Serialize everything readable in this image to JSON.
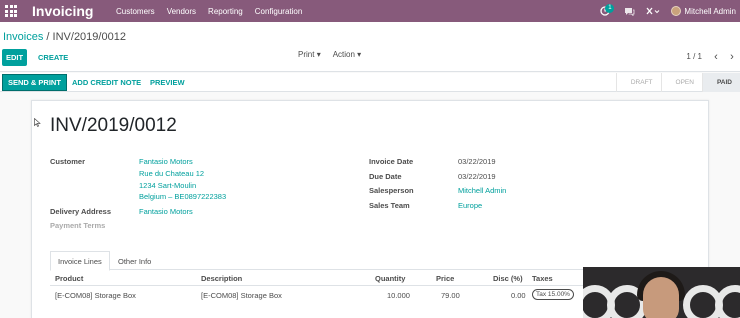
{
  "navbar": {
    "brand": "Invoicing",
    "menu": [
      "Customers",
      "Vendors",
      "Reporting",
      "Configuration"
    ],
    "chat_badge": "1",
    "user_name": "Mitchell Admin"
  },
  "control_panel": {
    "breadcrumb_parent": "Invoices",
    "breadcrumb_separator": "/",
    "breadcrumb_current": "INV/2019/0012",
    "edit_label": "EDIT",
    "create_label": "CREATE",
    "print_label": "Print",
    "action_label": "Action",
    "pager": "1 / 1"
  },
  "header_buttons": {
    "send_print": "SEND & PRINT",
    "add_credit_note": "ADD CREDIT NOTE",
    "preview": "PREVIEW"
  },
  "stages": [
    "DRAFT",
    "OPEN",
    "PAID"
  ],
  "active_stage": "PAID",
  "invoice": {
    "number": "INV/2019/0012",
    "customer_label": "Customer",
    "customer_name": "Fantasio Motors",
    "address_line1": "Rue du Chateau 12",
    "address_line2": "1234 Sart-Moulin",
    "address_line3": "Belgium – BE0897222383",
    "delivery_label": "Delivery Address",
    "delivery_value": "Fantasio Motors",
    "payment_terms_label": "Payment Terms",
    "invoice_date_label": "Invoice Date",
    "invoice_date": "03/22/2019",
    "due_date_label": "Due Date",
    "due_date": "03/22/2019",
    "salesperson_label": "Salesperson",
    "salesperson": "Mitchell Admin",
    "sales_team_label": "Sales Team",
    "sales_team": "Europe"
  },
  "tabs": [
    "Invoice Lines",
    "Other Info"
  ],
  "lines": {
    "headers": {
      "product": "Product",
      "description": "Description",
      "quantity": "Quantity",
      "price": "Price",
      "discount": "Disc (%)",
      "taxes": "Taxes"
    },
    "rows": [
      {
        "product": "[E-COM08] Storage Box",
        "description": "[E-COM08] Storage Box",
        "quantity": "10.000",
        "price": "79.00",
        "discount": "0.00",
        "tax": "Tax 15.00%"
      }
    ]
  },
  "colors": {
    "brand": "#875a7b",
    "accent": "#00a09d"
  }
}
